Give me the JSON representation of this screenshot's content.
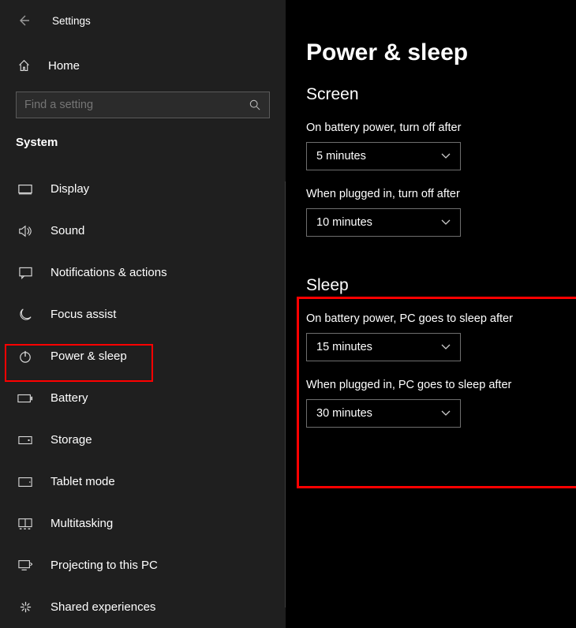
{
  "app_title": "Settings",
  "home_label": "Home",
  "search_placeholder": "Find a setting",
  "section_label": "System",
  "nav": [
    {
      "icon": "display",
      "label": "Display"
    },
    {
      "icon": "sound",
      "label": "Sound"
    },
    {
      "icon": "notifications",
      "label": "Notifications & actions"
    },
    {
      "icon": "focus",
      "label": "Focus assist"
    },
    {
      "icon": "power",
      "label": "Power & sleep"
    },
    {
      "icon": "battery",
      "label": "Battery"
    },
    {
      "icon": "storage",
      "label": "Storage"
    },
    {
      "icon": "tablet",
      "label": "Tablet mode"
    },
    {
      "icon": "multitask",
      "label": "Multitasking"
    },
    {
      "icon": "project",
      "label": "Projecting to this PC"
    },
    {
      "icon": "shared",
      "label": "Shared experiences"
    }
  ],
  "page": {
    "title": "Power & sleep",
    "screen": {
      "heading": "Screen",
      "battery_label": "On battery power, turn off after",
      "battery_value": "5 minutes",
      "plugged_label": "When plugged in, turn off after",
      "plugged_value": "10 minutes"
    },
    "sleep": {
      "heading": "Sleep",
      "battery_label": "On battery power, PC goes to sleep after",
      "battery_value": "15 minutes",
      "plugged_label": "When plugged in, PC goes to sleep after",
      "plugged_value": "30 minutes"
    }
  }
}
